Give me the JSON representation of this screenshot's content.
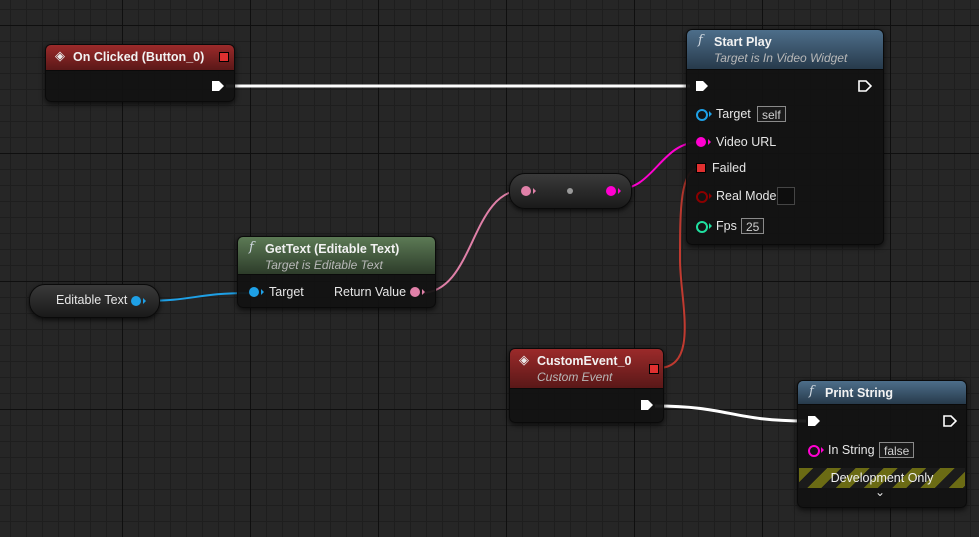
{
  "colors": {
    "exec": "#ffffff",
    "object_pin": "#1ea0e6",
    "string_pin": "#ff00d0",
    "text_pin": "#e080a8",
    "event_header": "#9b2a2a",
    "function_header": "#4d6e8a",
    "pure_function_header": "#5c7a55",
    "delegate_pin": "#e03030",
    "bool_pin": "#8b0000",
    "int_pin": "#20e0a0"
  },
  "nodes": {
    "on_clicked": {
      "title": "On Clicked (Button_0)",
      "icon": "event-diamond-icon"
    },
    "start_play": {
      "title": "Start Play",
      "subtitle": "Target is In Video Widget",
      "icon": "function-icon",
      "pins": {
        "target": {
          "label": "Target",
          "value": "self"
        },
        "video_url": {
          "label": "Video URL"
        },
        "failed": {
          "label": "Failed"
        },
        "real_mode": {
          "label": "Real Mode",
          "value": false
        },
        "fps": {
          "label": "Fps",
          "value": "25"
        }
      }
    },
    "get_text": {
      "title": "GetText (Editable Text)",
      "subtitle": "Target is Editable Text",
      "icon": "function-icon",
      "pins": {
        "target": {
          "label": "Target"
        },
        "return_value": {
          "label": "Return Value"
        }
      }
    },
    "editable_text_var": {
      "label": "Editable Text"
    },
    "conversion": {
      "type": "text-to-string"
    },
    "custom_event": {
      "title": "CustomEvent_0",
      "subtitle": "Custom Event",
      "icon": "event-diamond-icon"
    },
    "print_string": {
      "title": "Print String",
      "icon": "function-icon",
      "pins": {
        "in_string": {
          "label": "In String",
          "value": "false"
        }
      },
      "footer": "Development Only",
      "expand_icon": "chevron-down-icon"
    }
  }
}
